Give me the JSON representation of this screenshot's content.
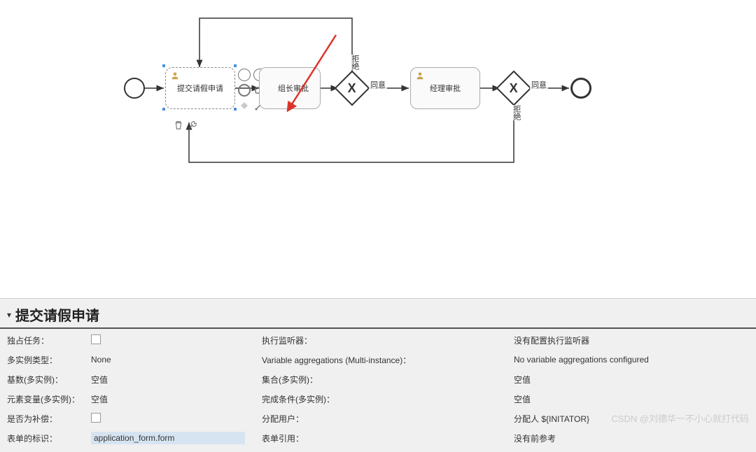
{
  "canvas": {
    "task1": "提交请假申请",
    "task2": "组长审批",
    "task3": "经理审批",
    "edge_agree1": "同意",
    "edge_agree2": "同意",
    "edge_reject1": "拒绝",
    "edge_reject2": "拒绝"
  },
  "properties": {
    "title": "提交请假申请",
    "col1": {
      "exclusive_task": "独占任务：",
      "multi_type_label": "多实例类型：",
      "multi_type_value": "None",
      "cardinality_label": "基数(多实例)：",
      "cardinality_value": "空值",
      "element_var_label": "元素变量(多实例)：",
      "element_var_value": "空值",
      "compensation_label": "是否为补偿：",
      "form_key_label": "表单的标识：",
      "form_key_value": "application_form.form"
    },
    "col2": {
      "exec_listener": "执行监听器：",
      "var_agg_label": "Variable aggregations (Multi-instance)：",
      "collection_label": "集合(多实例)：",
      "collection_value": "空值",
      "completion_label": "完成条件(多实例)：",
      "completion_value": "空值",
      "assign_user_label": "分配用户：",
      "form_ref_label": "表单引用："
    },
    "col3": {
      "no_listener": "没有配置执行监听器",
      "no_var_agg": "No variable aggregations configured",
      "empty2": "空值",
      "assign_value": "分配人 ${INITATOR}",
      "ref_value": "没有前参考"
    }
  },
  "watermark": "CSDN @刘德华一不小心就打代码"
}
